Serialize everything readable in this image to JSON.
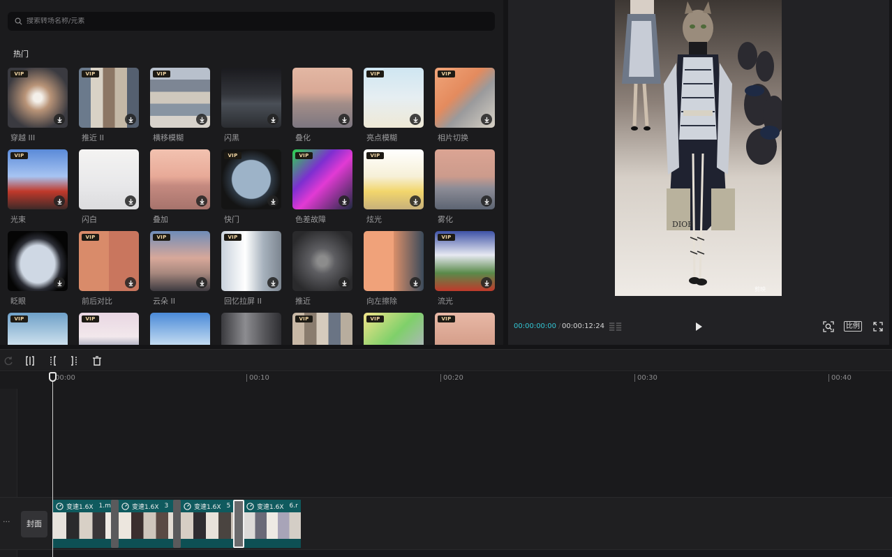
{
  "search": {
    "placeholder": "搜索转场名称/元素"
  },
  "section": {
    "title": "热门"
  },
  "transitions": [
    {
      "label": "穿越 III",
      "vip": true
    },
    {
      "label": "推近 II",
      "vip": true
    },
    {
      "label": "横移模糊",
      "vip": true
    },
    {
      "label": "闪黑",
      "vip": false
    },
    {
      "label": "叠化",
      "vip": false
    },
    {
      "label": "亮点模糊",
      "vip": true
    },
    {
      "label": "相片切换",
      "vip": true
    },
    {
      "label": "光束",
      "vip": true
    },
    {
      "label": "闪白",
      "vip": false
    },
    {
      "label": "叠加",
      "vip": false
    },
    {
      "label": "快门",
      "vip": true
    },
    {
      "label": "色差故障",
      "vip": true
    },
    {
      "label": "炫光",
      "vip": true
    },
    {
      "label": "雾化",
      "vip": false
    },
    {
      "label": "眨眼",
      "vip": false
    },
    {
      "label": "前后对比",
      "vip": true
    },
    {
      "label": "云朵 II",
      "vip": true
    },
    {
      "label": "回忆拉屏 II",
      "vip": true
    },
    {
      "label": "推近",
      "vip": false
    },
    {
      "label": "向左擦除",
      "vip": false
    },
    {
      "label": "流光",
      "vip": true
    },
    {
      "label": "",
      "vip": true
    },
    {
      "label": "",
      "vip": true
    },
    {
      "label": "",
      "vip": false
    },
    {
      "label": "",
      "vip": false
    },
    {
      "label": "",
      "vip": true
    },
    {
      "label": "",
      "vip": true
    },
    {
      "label": "",
      "vip": true
    }
  ],
  "vip_badge": "VIP",
  "player": {
    "current_time": "00:00:00:00",
    "separator": "/",
    "total_time": "00:00:12:24",
    "ratio_label": "比例",
    "watermark": "剪映",
    "bag_logo": "DIOR"
  },
  "timeline": {
    "ruler_ticks": [
      "00:00",
      "00:10",
      "00:20",
      "00:30",
      "00:40"
    ],
    "more_label": "···",
    "cover_label": "封面",
    "clips": [
      {
        "speed": "变速1.6X",
        "filename": "1.m"
      },
      {
        "speed": "变速1.6X",
        "filename": "3"
      },
      {
        "speed": "变速1.6X",
        "filename": "5"
      },
      {
        "speed": "变速1.6X",
        "filename": "6.r"
      }
    ]
  }
}
